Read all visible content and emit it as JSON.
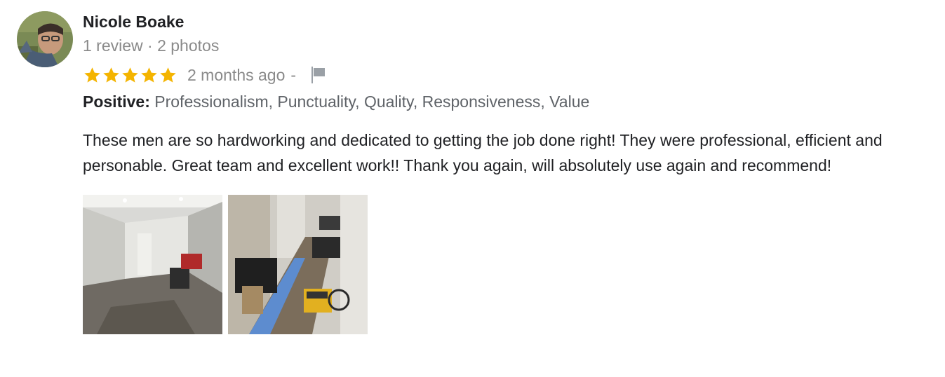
{
  "reviewer": {
    "name": "Nicole Boake",
    "meta": "1 review · 2 photos"
  },
  "rating": {
    "stars": 5,
    "max": 5,
    "time": "2 months ago",
    "separator": "-"
  },
  "positive": {
    "label": "Positive:",
    "items": "Professionalism, Punctuality, Quality, Responsiveness, Value"
  },
  "review_text": "These men are so hardworking and dedicated to getting the job done right! They were professional, efficient and personable. Great team and excellent work!! Thank you again, will absolutely use again and recommend!",
  "colors": {
    "star": "#f4b400",
    "muted": "#8a8a8a",
    "text": "#202124",
    "flag": "#9aa0a6"
  },
  "icons": {
    "star": "star-icon",
    "flag": "flag-icon"
  }
}
